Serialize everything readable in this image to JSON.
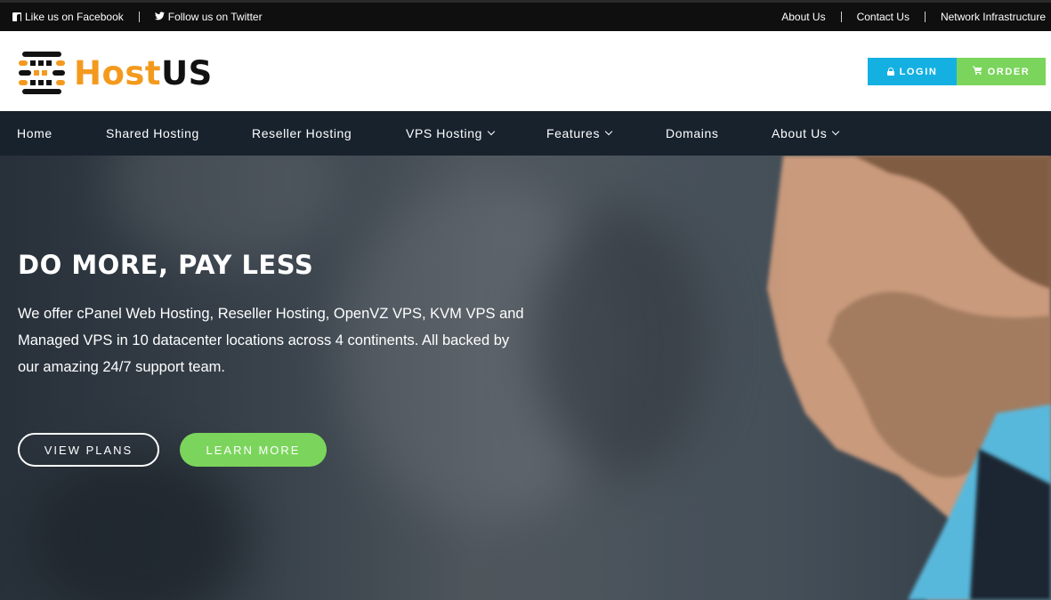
{
  "topbar": {
    "facebook": "Like us on Facebook",
    "twitter": "Follow us on Twitter",
    "links": [
      "About Us",
      "Contact Us",
      "Network Infrastructure"
    ]
  },
  "brand": {
    "host": "Host",
    "us": "US",
    "colors": {
      "orange": "#f39a1e",
      "dark": "#111111"
    }
  },
  "header": {
    "login_label": "LOGIN",
    "order_label": "ORDER",
    "login_color": "#15b0e2",
    "order_color": "#7bd55c"
  },
  "nav": {
    "items": [
      {
        "label": "Home",
        "dropdown": false
      },
      {
        "label": "Shared Hosting",
        "dropdown": false
      },
      {
        "label": "Reseller Hosting",
        "dropdown": false
      },
      {
        "label": "VPS Hosting",
        "dropdown": true
      },
      {
        "label": "Features",
        "dropdown": true
      },
      {
        "label": "Domains",
        "dropdown": false
      },
      {
        "label": "About Us",
        "dropdown": true
      }
    ]
  },
  "hero": {
    "title": "DO MORE, PAY LESS",
    "text": "We offer cPanel Web Hosting, Reseller Hosting, OpenVZ VPS, KVM VPS and Managed VPS in 10 datacenter locations across 4 continents. All backed by our amazing 24/7 support team.",
    "view_plans": "VIEW PLANS",
    "learn_more": "LEARN MORE"
  },
  "icons": {
    "facebook": "facebook-icon",
    "twitter": "twitter-icon",
    "lock": "lock-icon",
    "cart": "cart-icon",
    "chevron": "chevron-down-icon"
  }
}
